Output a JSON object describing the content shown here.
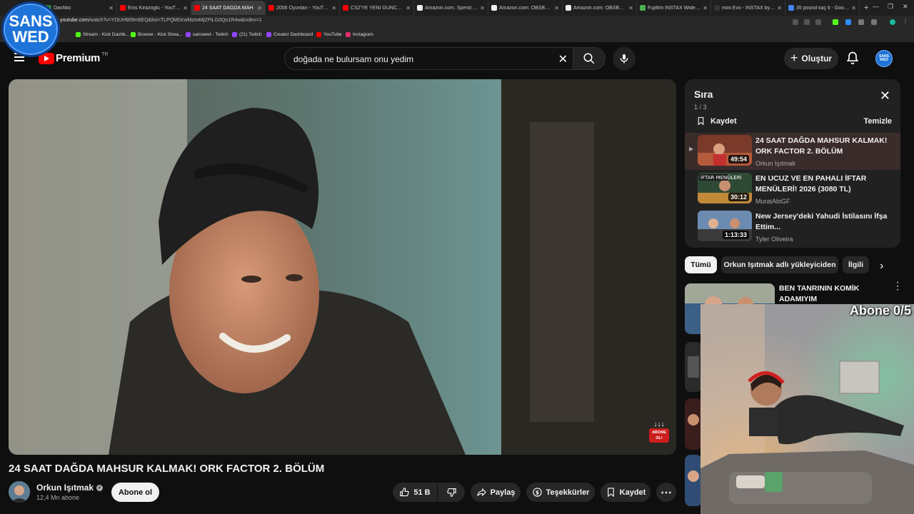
{
  "browser": {
    "tabs": [
      {
        "title": "Dashbo",
        "color": "#2e7d32",
        "active": false
      },
      {
        "title": "Enis Kirazoglu - YouTube",
        "color": "#ff0000",
        "active": false
      },
      {
        "title": "24 SAAT DAĞDA MAH",
        "color": "#ff0000",
        "active": true
      },
      {
        "title": "2006 Oyunları - YouTube",
        "color": "#ff0000",
        "active": false
      },
      {
        "title": "CS2'YE YENİ GÜNCELLEME",
        "color": "#ff0000",
        "active": false
      },
      {
        "title": "Amazon.com. Spend less",
        "color": "#eeeeee",
        "active": false
      },
      {
        "title": "Amazon.com: OBSBOT M",
        "color": "#eeeeee",
        "active": false
      },
      {
        "title": "Amazon.com: OBSBOT Ti",
        "color": "#eeeeee",
        "active": false
      },
      {
        "title": "Fujifilm INSTAX Wide Evo",
        "color": "#4caf50",
        "active": false
      },
      {
        "title": "mini Evo - INSTAX by Fuji",
        "color": "#333333",
        "active": false
      },
      {
        "title": "35 pound kaç tl - Google",
        "color": "#4285f4",
        "active": false
      }
    ],
    "new_tab": "+",
    "url_domain": "youtube.com",
    "url_path": "/watch?v=YOUH909m6EQ&list=TLPQMDcwMzIwMjZPiLG0Qo1R4w&index=1",
    "bookmarks": [
      {
        "label": "Stream - Kick Dashb...",
        "color": "#53fc18"
      },
      {
        "label": "Browse - Kick Strea...",
        "color": "#53fc18"
      },
      {
        "label": "sanswed - Twitch",
        "color": "#9146ff"
      },
      {
        "label": "(21) Twitch",
        "color": "#9146ff"
      },
      {
        "label": "Creator Dashboard",
        "color": "#9146ff"
      },
      {
        "label": "YouTube",
        "color": "#ff0000"
      },
      {
        "label": "Instagram",
        "color": "#e1306c"
      }
    ]
  },
  "overlay_logo": {
    "line1": "SANS",
    "line2": "WED"
  },
  "youtube": {
    "logo_text": "Premium",
    "country_code": "TR",
    "search_query": "doğada ne bulursam onu yedim",
    "create_label": "Oluştur",
    "avatar_text": "SANS WED"
  },
  "video": {
    "title": "24 SAAT DAĞDA MAHSUR KALMAK! ORK FACTOR 2. BÖLÜM",
    "channel": "Orkun Işıtmak",
    "subscribers": "12,4 Mn abone",
    "subscribe_label": "Abone ol",
    "likes": "51 B",
    "share_label": "Paylaş",
    "thanks_label": "Teşekkürler",
    "save_label": "Kaydet",
    "subscribe_reminder": "ABONE OL!"
  },
  "queue": {
    "title": "Sıra",
    "position": "1 / 3",
    "save_label": "Kaydet",
    "clear_label": "Temizle",
    "items": [
      {
        "title": "24 SAAT DAĞDA MAHSUR KALMAK! ORK FACTOR 2. BÖLÜM",
        "channel": "Orkun Işıtmak",
        "duration": "49:54"
      },
      {
        "title": "EN UCUZ VE EN PAHALI İFTAR MENÜLERİ! 2026 (3080 TL)",
        "channel": "MuratAbiGF",
        "duration": "30:12"
      },
      {
        "title": "New Jersey'deki Yahudi İstilasını İfşa Ettim...",
        "channel": "Tyler Oliveira",
        "duration": "1:13:33"
      }
    ]
  },
  "chips": [
    "Tümü",
    "Orkun Işıtmak adlı yükleyiciden",
    "İlgili"
  ],
  "recommendations": [
    {
      "title": "BEN TANRININ KOMİK ADAMIYIM"
    }
  ],
  "stream_overlay": {
    "subscriber_goal": "Abone 0/5"
  }
}
